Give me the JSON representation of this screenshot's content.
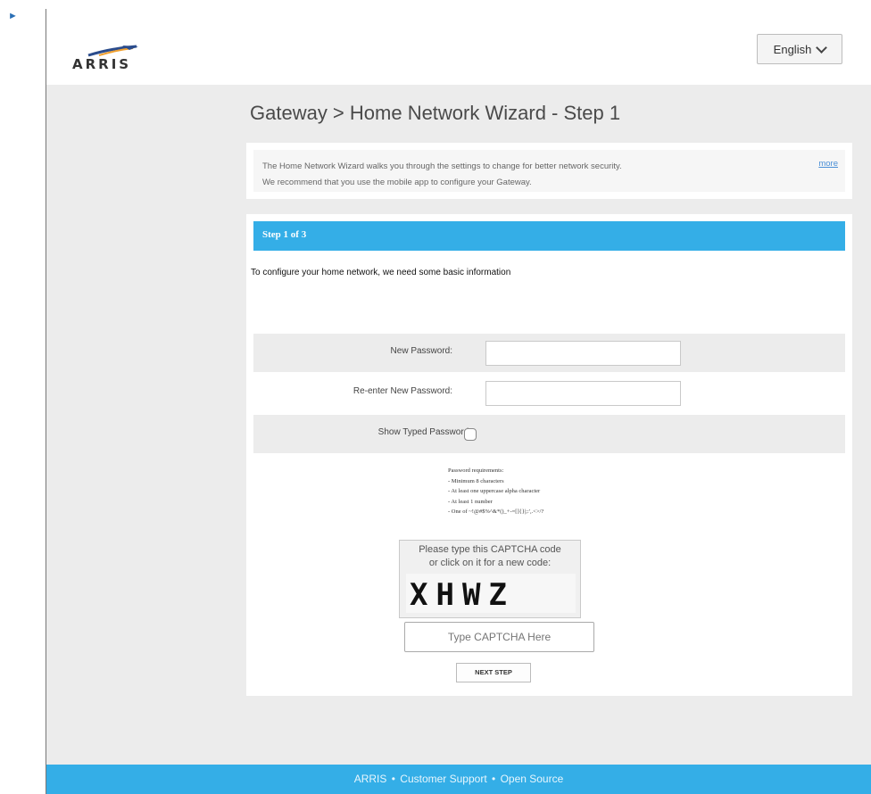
{
  "header": {
    "logo_text": "ARRIS",
    "language": "English"
  },
  "page": {
    "title": "Gateway > Home Network Wizard - Step 1"
  },
  "intro": {
    "line1": "The Home Network Wizard walks you through the settings to change for better network security.",
    "line2": "We recommend that you use the mobile app to configure your Gateway.",
    "more_link": "more"
  },
  "wizard": {
    "step_label": "Step 1 of 3",
    "description": "To configure your home network, we need some basic information",
    "fields": {
      "new_password_label": "New Password:",
      "reenter_password_label": "Re-enter New Password:",
      "show_typed_label": "Show Typed Password:"
    },
    "requirements": {
      "heading": "Password requirements:",
      "items": [
        "- Minimum 8 characters",
        "- At least one uppercase alpha character",
        "- At least 1 number",
        "- One of ~!@#$%^&*()_+-=[]{}|;:',.<>/?"
      ]
    },
    "captcha": {
      "caption_line1": "Please type this CAPTCHA code",
      "caption_line2": "or click on it for a new code:",
      "code": "XHWZ",
      "input_placeholder": "Type CAPTCHA Here"
    },
    "next_button": "NEXT STEP"
  },
  "footer": {
    "links": [
      "ARRIS",
      "Customer Support",
      "Open Source"
    ],
    "separator": "•"
  },
  "colors": {
    "accent": "#34aee7",
    "background": "#ececec",
    "link": "#4a8fd6"
  }
}
